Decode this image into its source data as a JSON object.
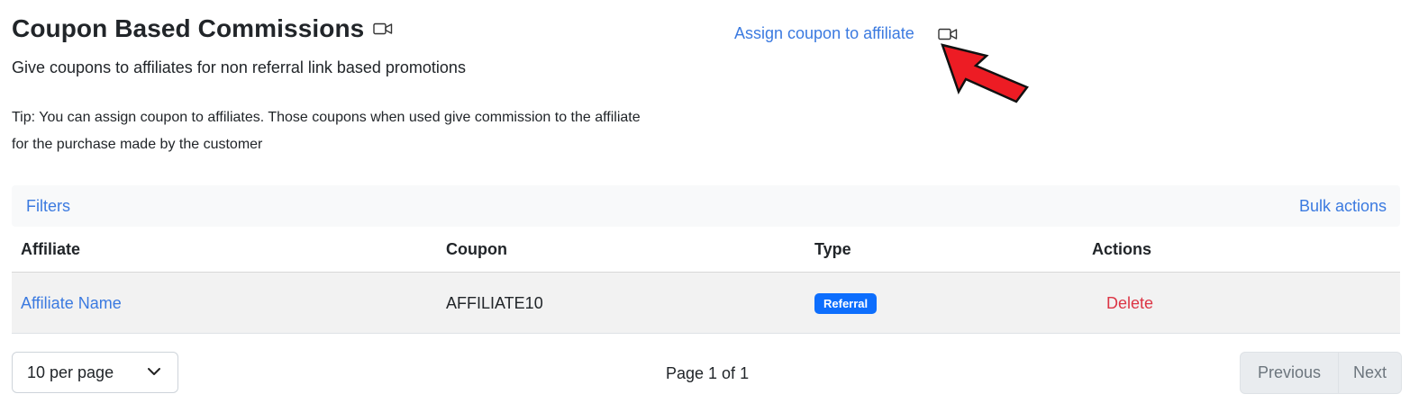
{
  "header": {
    "title": "Coupon Based Commissions",
    "title_icon": "video-camera-icon",
    "subtitle": "Give coupons to affiliates for non referral link based promotions",
    "tip": "Tip: You can assign coupon to affiliates. Those coupons when used give commission to the affiliate for the purchase made by the customer"
  },
  "actions": {
    "assign_label": "Assign coupon to affiliate",
    "assign_icon": "video-camera-icon",
    "annotation_arrow_color": "#ed1c24"
  },
  "toolbar": {
    "filters_label": "Filters",
    "bulk_actions_label": "Bulk actions"
  },
  "table": {
    "columns": [
      "Affiliate",
      "Coupon",
      "Type",
      "Actions"
    ],
    "rows": [
      {
        "affiliate": "Affiliate Name",
        "coupon": "AFFILIATE10",
        "type": "Referral",
        "action": "Delete"
      }
    ]
  },
  "pagination": {
    "per_page": "10 per page",
    "page_info": "Page 1 of 1",
    "previous_label": "Previous",
    "next_label": "Next"
  },
  "colors": {
    "link": "#3b7ae0",
    "badge": "#0d6efd",
    "danger": "#dc3545"
  }
}
